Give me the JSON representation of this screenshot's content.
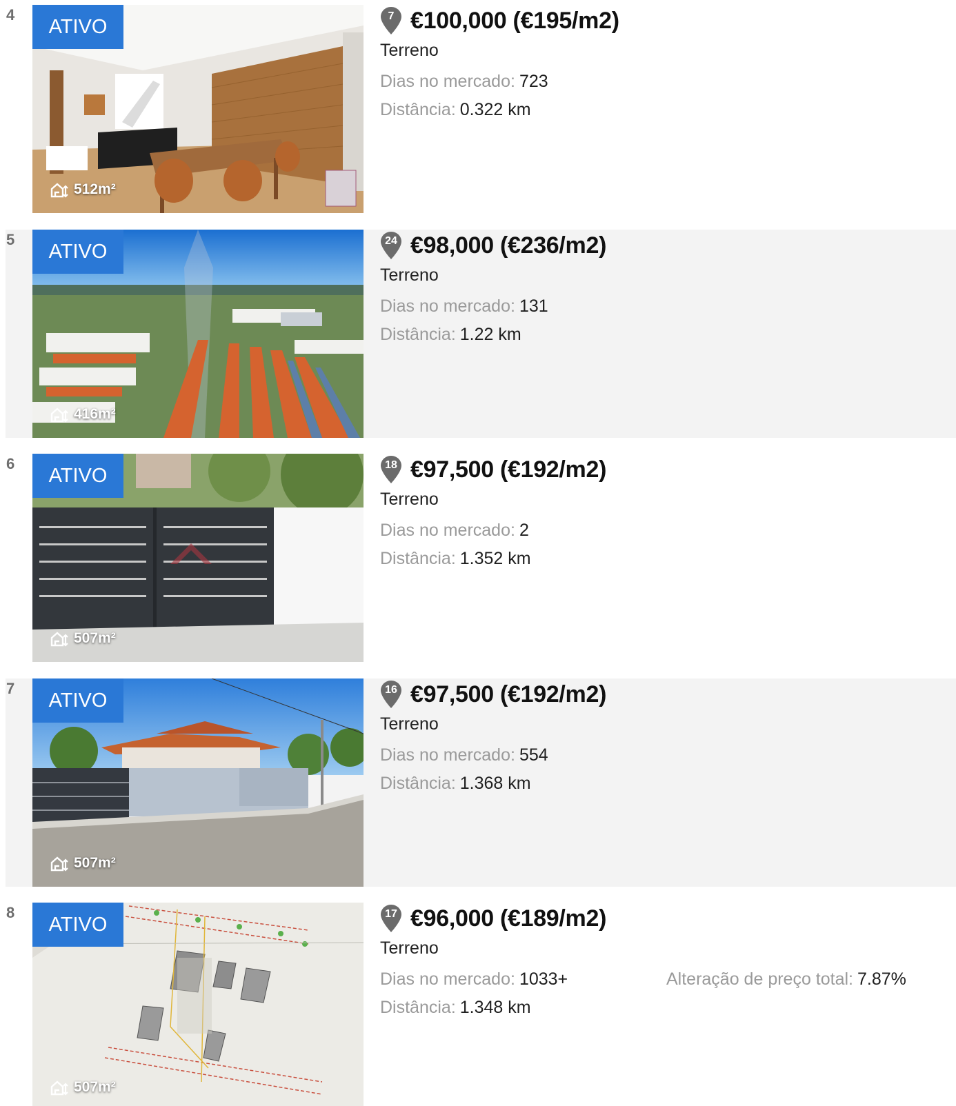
{
  "status_label": "ATIVO",
  "labels": {
    "days_on_market": "Dias no mercado:",
    "distance": "Distância:",
    "total_price_change": "Alteração de preço total:"
  },
  "colors": {
    "badge_bg": "#2a78d6",
    "pin": "#6b6b6b",
    "alt_row_bg": "#f3f3f3"
  },
  "area_icon": "land-area-icon",
  "pin_icon": "map-pin-icon",
  "listings": [
    {
      "index": "4",
      "pin": "7",
      "price": "€100,000 (€195/m2)",
      "type": "Terreno",
      "days": "723",
      "distance": "0.322 km",
      "area": "512m²",
      "photo": "interior-room-photo"
    },
    {
      "index": "5",
      "pin": "24",
      "price": "€98,000 (€236/m2)",
      "type": "Terreno",
      "days": "131",
      "distance": "1.22 km",
      "area": "416m²",
      "photo": "aerial-neighborhood-photo"
    },
    {
      "index": "6",
      "pin": "18",
      "price": "€97,500 (€192/m2)",
      "type": "Terreno",
      "days": "2",
      "distance": "1.352 km",
      "area": "507m²",
      "photo": "gate-wall-photo"
    },
    {
      "index": "7",
      "pin": "16",
      "price": "€97,500 (€192/m2)",
      "type": "Terreno",
      "days": "554",
      "distance": "1.368 km",
      "area": "507m²",
      "photo": "street-view-photo"
    },
    {
      "index": "8",
      "pin": "17",
      "price": "€96,000 (€189/m2)",
      "type": "Terreno",
      "days": "1033+",
      "distance": "1.348 km",
      "area": "507m²",
      "price_change": "7.87%",
      "photo": "site-plan-photo"
    }
  ]
}
